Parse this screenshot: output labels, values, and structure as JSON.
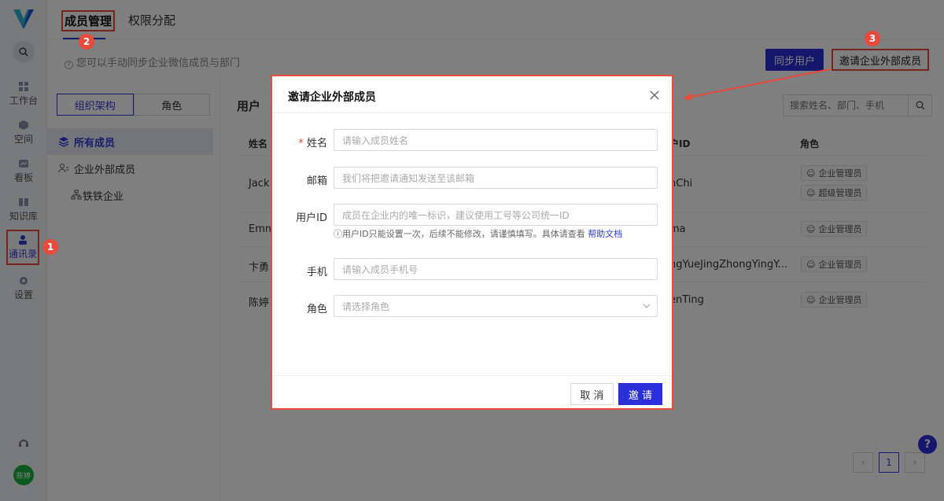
{
  "sidebar": {
    "items": [
      {
        "label": "工作台",
        "icon": "grid-icon"
      },
      {
        "label": "空间",
        "icon": "cube-icon"
      },
      {
        "label": "看板",
        "icon": "dashboard-icon"
      },
      {
        "label": "知识库",
        "icon": "book-icon"
      },
      {
        "label": "通讯录",
        "icon": "contacts-icon"
      },
      {
        "label": "设置",
        "icon": "gear-icon"
      }
    ],
    "avatar": "陈婷"
  },
  "header": {
    "tabs": [
      {
        "label": "成员管理"
      },
      {
        "label": "权限分配"
      }
    ]
  },
  "subbar": {
    "hint": "您可以手动同步企业微信成员与部门",
    "sync_label": "同步用户",
    "invite_external_label": "邀请企业外部成员"
  },
  "leftpanel": {
    "segments": [
      "组织架构",
      "角色"
    ],
    "tree": [
      {
        "label": "所有成员"
      },
      {
        "label": "企业外部成员"
      },
      {
        "label": "铁铁企业"
      }
    ]
  },
  "main": {
    "title": "用户",
    "search_placeholder": "搜索姓名、部门、手机",
    "columns": {
      "name": "姓名",
      "userid": "户ID",
      "role": "角色"
    },
    "rows": [
      {
        "name": "Jack",
        "userid": "nChi",
        "roles": [
          "企业管理员",
          "超级管理员"
        ]
      },
      {
        "name": "Emm",
        "userid": "ma",
        "roles": [
          "企业管理员"
        ]
      },
      {
        "name": "卞勇",
        "userid": "ngYueJingZhongYingY...",
        "roles": [
          "企业管理员"
        ]
      },
      {
        "name": "陈婷",
        "userid": "enTing",
        "roles": [
          "企业管理员"
        ]
      }
    ],
    "pager": {
      "current": "1"
    }
  },
  "modal": {
    "title": "邀请企业外部成员",
    "fields": {
      "name": {
        "label": "姓名",
        "placeholder": "请输入成员姓名"
      },
      "email": {
        "label": "邮箱",
        "placeholder": "我们将把邀请通知发送至该邮箱"
      },
      "userid": {
        "label": "用户ID",
        "placeholder": "成员在企业内的唯一标识，建议使用工号等公司统一ID"
      },
      "phone": {
        "label": "手机",
        "placeholder": "请输入成员手机号"
      },
      "role": {
        "label": "角色",
        "placeholder": "请选择角色"
      }
    },
    "userid_help": "用户ID只能设置一次，后续不能修改，请谨慎填写。具体请查看",
    "userid_help_link": "帮助文档",
    "cancel_label": "取 消",
    "invite_label": "邀 请"
  },
  "annotations": {
    "badge1": "1",
    "badge2": "2",
    "badge3": "3"
  },
  "colors": {
    "accent": "#2a2fd9",
    "highlight": "#e84a3c"
  }
}
